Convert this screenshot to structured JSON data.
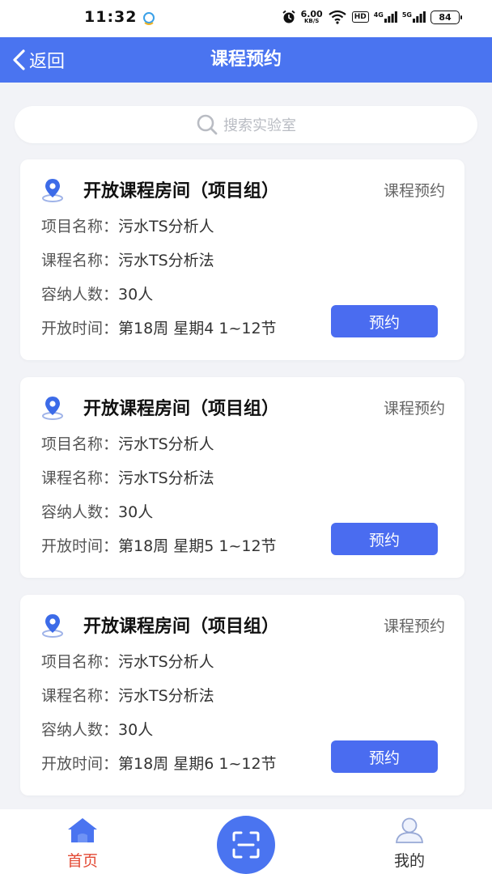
{
  "status_bar": {
    "time": "11:32",
    "net_speed_value": "6.00",
    "net_speed_unit": "KB/S",
    "hd_label": "HD",
    "net1_label": "4G",
    "net2_label": "5G",
    "battery": "84"
  },
  "nav": {
    "back_label": "返回",
    "title": "课程预约"
  },
  "search": {
    "placeholder": "搜索实验室"
  },
  "cards": [
    {
      "title": "开放课程房间（项目组）",
      "action": "课程预约",
      "project_key": "项目名称：",
      "project_value": "污水TS分析人",
      "course_key": "课程名称：",
      "course_value": "污水TS分析法",
      "capacity_key": "容纳人数：",
      "capacity_value": "30人",
      "time_key": "开放时间：",
      "time_value": "第18周 星期4 1~12节",
      "button": "预约"
    },
    {
      "title": "开放课程房间（项目组）",
      "action": "课程预约",
      "project_key": "项目名称：",
      "project_value": "污水TS分析人",
      "course_key": "课程名称：",
      "course_value": "污水TS分析法",
      "capacity_key": "容纳人数：",
      "capacity_value": "30人",
      "time_key": "开放时间：",
      "time_value": "第18周 星期5 1~12节",
      "button": "预约"
    },
    {
      "title": "开放课程房间（项目组）",
      "action": "课程预约",
      "project_key": "项目名称：",
      "project_value": "污水TS分析人",
      "course_key": "课程名称：",
      "course_value": "污水TS分析法",
      "capacity_key": "容纳人数：",
      "capacity_value": "30人",
      "time_key": "开放时间：",
      "time_value": "第18周 星期6 1~12节",
      "button": "预约"
    }
  ],
  "tabs": {
    "home_label": "首页",
    "mine_label": "我的"
  },
  "icons": {
    "back": "chevron-left-icon",
    "search": "search-icon",
    "location": "location-pin-icon",
    "home": "home-icon",
    "scan": "scan-icon",
    "user": "user-icon"
  },
  "colors": {
    "primary": "#4a74f0",
    "button": "#4a6cf0",
    "tab_active": "#e34a35",
    "background": "#f2f3f7"
  }
}
